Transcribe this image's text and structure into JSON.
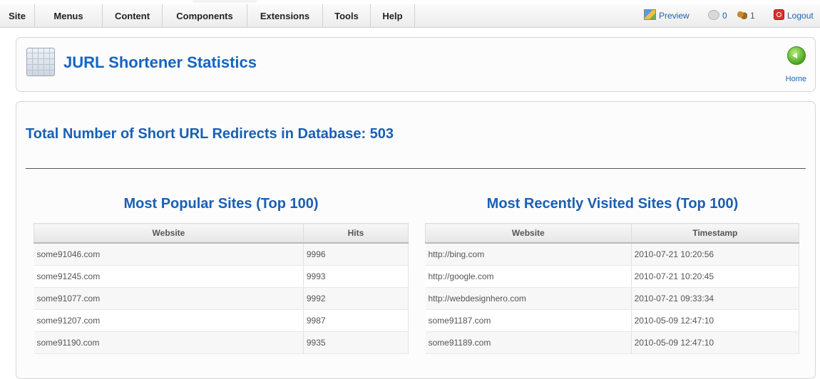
{
  "menubar": {
    "items": [
      "Site",
      "Menus",
      "Content",
      "Components",
      "Extensions",
      "Tools",
      "Help"
    ],
    "status": {
      "preview_label": "Preview",
      "messages_count": "0",
      "users_count": "1",
      "logout_label": "Logout"
    }
  },
  "header": {
    "title": "JURL Shortener Statistics",
    "home_label": "Home"
  },
  "main": {
    "total_heading": "Total Number of Short URL Redirects in Database: 503",
    "popular": {
      "title": "Most Popular Sites (Top 100)",
      "columns": [
        "Website",
        "Hits"
      ],
      "rows": [
        [
          "some91046.com",
          "9996"
        ],
        [
          "some91245.com",
          "9993"
        ],
        [
          "some91077.com",
          "9992"
        ],
        [
          "some91207.com",
          "9987"
        ],
        [
          "some91190.com",
          "9935"
        ]
      ]
    },
    "recent": {
      "title": "Most Recently Visited Sites (Top 100)",
      "columns": [
        "Website",
        "Timestamp"
      ],
      "rows": [
        [
          "http://bing.com",
          "2010-07-21 10:20:56"
        ],
        [
          "http://google.com",
          "2010-07-21 10:20:45"
        ],
        [
          "http://webdesignhero.com",
          "2010-07-21 09:33:34"
        ],
        [
          "some91187.com",
          "2010-05-09 12:47:10"
        ],
        [
          "some91189.com",
          "2010-05-09 12:47:10"
        ]
      ]
    }
  }
}
